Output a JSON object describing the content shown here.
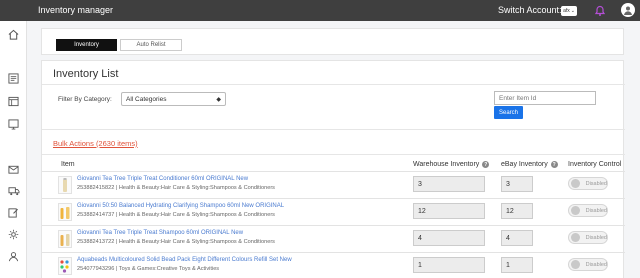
{
  "app": {
    "title": "Inventory manager"
  },
  "header": {
    "switch_label": "Switch Account:",
    "account_value": "afx"
  },
  "tabs": [
    {
      "label": "Inventory",
      "active": true
    },
    {
      "label": "Auto Relist",
      "active": false
    }
  ],
  "list": {
    "title": "Inventory List",
    "filter_label": "Filter By Category:",
    "filter_value": "All Categories",
    "item_id_placeholder": "Enter Item Id",
    "search_label": "Search",
    "bulk_actions": "Bulk Actions (2630 items)"
  },
  "table": {
    "headers": {
      "item": "Item",
      "warehouse": "Warehouse Inventory",
      "ebay": "eBay Inventory",
      "control": "Inventory Control"
    },
    "help_glyph": "?",
    "rows": [
      {
        "title": "Giovanni Tea Tree Triple Treat Conditioner 60ml ORIGINAL New",
        "meta": "253882415822 | Health & Beauty:Hair Care & Styling:Shampoos & Conditioners",
        "warehouse": "3",
        "ebay": "3",
        "control": "Disabled"
      },
      {
        "title": "Giovanni 50:50 Balanced Hydrating Clarifying Shampoo 60ml New ORIGINAL",
        "meta": "253882414737 | Health & Beauty:Hair Care & Styling:Shampoos & Conditioners",
        "warehouse": "12",
        "ebay": "12",
        "control": "Disabled"
      },
      {
        "title": "Giovanni Tea Tree Triple Treat Shampoo 60ml ORIGINAL New",
        "meta": "253882413722 | Health & Beauty:Hair Care & Styling:Shampoos & Conditioners",
        "warehouse": "4",
        "ebay": "4",
        "control": "Disabled"
      },
      {
        "title": "Aquabeads Multicoloured Solid Bead Pack Eight Different Colours Refill Set New",
        "meta": "254077943296 | Toys & Games:Creative Toys & Activities",
        "warehouse": "1",
        "ebay": "1",
        "control": "Disabled"
      }
    ]
  },
  "colors": {
    "topbar": "#3f3f3f",
    "link": "#4a7bd0",
    "bulk": "#e0523a",
    "button": "#1a73e8"
  }
}
